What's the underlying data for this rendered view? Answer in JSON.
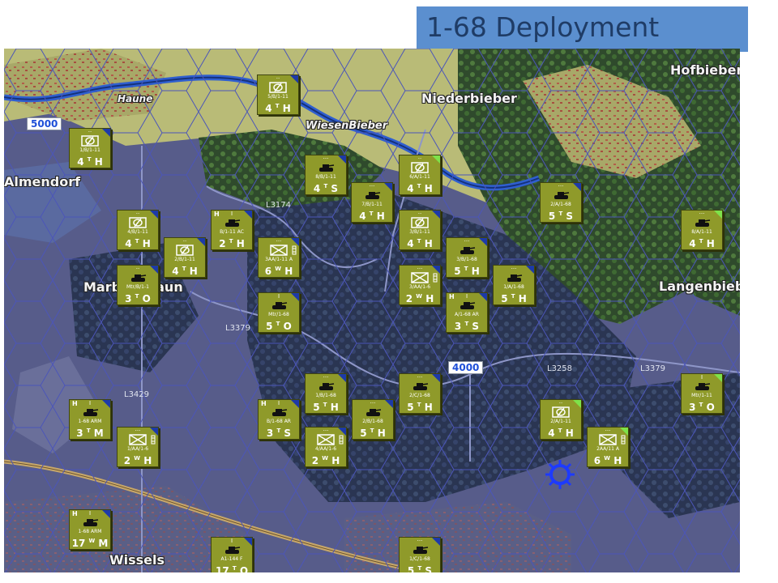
{
  "banner": {
    "title": "1-68 Deployment"
  },
  "colors": {
    "banner_bg": "#5b8fcf",
    "banner_text": "#1f3c66",
    "counter_olive": "#8f9a2a",
    "corner_blue": "#1d3aa8",
    "corner_green": "#7ee24a",
    "coord_text": "#1f4fd8"
  },
  "map": {
    "towns": [
      {
        "id": "hofbieber",
        "name": "Hofbieber"
      },
      {
        "id": "niederbieber",
        "name": "Niederbieber"
      },
      {
        "id": "wiesenbieber",
        "name": "WiesenBieber"
      },
      {
        "id": "haune",
        "name": "Haune"
      },
      {
        "id": "almendorf",
        "name": "Almendorf"
      },
      {
        "id": "marbachhaun",
        "name": "Marbachhaun"
      },
      {
        "id": "langenbieber",
        "name": "Langenbiebe"
      },
      {
        "id": "wissels",
        "name": "Wissels"
      }
    ],
    "roads": [
      "L3174",
      "L3379",
      "L3429",
      "L3258",
      "L3379"
    ],
    "coord_labels": [
      "5000",
      "4000"
    ]
  },
  "units": [
    {
      "size": "··",
      "hq": "",
      "type": "recon",
      "id": "5/B/1-11",
      "stat": "4",
      "sup": "T",
      "class": "H",
      "corner": "blue"
    },
    {
      "size": "··",
      "hq": "",
      "type": "recon",
      "id": "1/B/1-11",
      "stat": "4",
      "sup": "T",
      "class": "H",
      "corner": "blue"
    },
    {
      "size": "···",
      "hq": "",
      "type": "tank",
      "id": "8/B/1-11",
      "stat": "4",
      "sup": "T",
      "class": "S",
      "corner": "blue"
    },
    {
      "size": "··",
      "hq": "",
      "type": "recon",
      "id": "6/A/1-11",
      "stat": "4",
      "sup": "T",
      "class": "H",
      "corner": "green"
    },
    {
      "size": "···",
      "hq": "",
      "type": "tank",
      "id": "7/B/1-11",
      "stat": "4",
      "sup": "T",
      "class": "H",
      "corner": "blue"
    },
    {
      "size": "···",
      "hq": "",
      "type": "tank",
      "id": "2/A/1-68",
      "stat": "5",
      "sup": "T",
      "class": "S",
      "corner": "blue"
    },
    {
      "size": "··",
      "hq": "",
      "type": "recon",
      "id": "4/B/1-11",
      "stat": "4",
      "sup": "T",
      "class": "H",
      "corner": "blue"
    },
    {
      "size": "I",
      "hq": "H",
      "type": "tank",
      "id": "B/1-11 AC",
      "stat": "2",
      "sup": "T",
      "class": "H",
      "corner": "blue"
    },
    {
      "size": "··",
      "hq": "",
      "type": "recon",
      "id": "3/B/1-11",
      "stat": "4",
      "sup": "T",
      "class": "H",
      "corner": "blue"
    },
    {
      "size": "···",
      "hq": "",
      "type": "tank",
      "id": "8/A/1-11",
      "stat": "4",
      "sup": "T",
      "class": "H",
      "corner": "green"
    },
    {
      "size": "··",
      "hq": "",
      "type": "recon",
      "id": "2/B/1-11",
      "stat": "4",
      "sup": "T",
      "class": "H",
      "corner": "blue"
    },
    {
      "size": "···",
      "hq": "",
      "type": "infantry",
      "id": "3AA/1-11 A",
      "stat": "6",
      "sup": "W",
      "class": "H",
      "corner": "blue"
    },
    {
      "size": "···",
      "hq": "",
      "type": "tank",
      "id": "3/B/1-68",
      "stat": "5",
      "sup": "T",
      "class": "H",
      "corner": "blue"
    },
    {
      "size": "··",
      "hq": "",
      "type": "tank",
      "id": "Mtr/B/1-1",
      "stat": "3",
      "sup": "T",
      "class": "O",
      "corner": "blue"
    },
    {
      "size": "···",
      "hq": "",
      "type": "infantry",
      "id": "3/AA/1-6",
      "stat": "2",
      "sup": "W",
      "class": "H",
      "corner": "blue"
    },
    {
      "size": "···",
      "hq": "",
      "type": "tank",
      "id": "1/A/1-68",
      "stat": "5",
      "sup": "T",
      "class": "H",
      "corner": "blue"
    },
    {
      "size": "I",
      "hq": "",
      "type": "tank",
      "id": "Mtr/1-68",
      "stat": "5",
      "sup": "T",
      "class": "O",
      "corner": "blue"
    },
    {
      "size": "I",
      "hq": "H",
      "type": "tank",
      "id": "A/1-68 AR",
      "stat": "3",
      "sup": "T",
      "class": "S",
      "corner": "blue"
    },
    {
      "size": "···",
      "hq": "",
      "type": "tank",
      "id": "1/B/1-68",
      "stat": "5",
      "sup": "T",
      "class": "H",
      "corner": "blue"
    },
    {
      "size": "···",
      "hq": "",
      "type": "tank",
      "id": "2/C/1-68",
      "stat": "5",
      "sup": "T",
      "class": "H",
      "corner": "blue"
    },
    {
      "size": "I",
      "hq": "",
      "type": "tank",
      "id": "Mtr/1-11",
      "stat": "3",
      "sup": "T",
      "class": "O",
      "corner": "green"
    },
    {
      "size": "I",
      "hq": "H",
      "type": "tank",
      "id": "1-68 ARM",
      "stat": "3",
      "sup": "T",
      "class": "M",
      "corner": "blue"
    },
    {
      "size": "I",
      "hq": "H",
      "type": "tank",
      "id": "B/1-68 AR",
      "stat": "3",
      "sup": "T",
      "class": "S",
      "corner": "blue"
    },
    {
      "size": "···",
      "hq": "",
      "type": "tank",
      "id": "2/B/1-68",
      "stat": "5",
      "sup": "T",
      "class": "H",
      "corner": "blue"
    },
    {
      "size": "··",
      "hq": "",
      "type": "recon",
      "id": "2/A/1-11",
      "stat": "4",
      "sup": "T",
      "class": "H",
      "corner": "green"
    },
    {
      "size": "···",
      "hq": "",
      "type": "infantry",
      "id": "1/AA/1-6",
      "stat": "2",
      "sup": "W",
      "class": "H",
      "corner": "blue"
    },
    {
      "size": "···",
      "hq": "",
      "type": "infantry",
      "id": "4/AA/1-6",
      "stat": "2",
      "sup": "W",
      "class": "H",
      "corner": "blue"
    },
    {
      "size": "···",
      "hq": "",
      "type": "infantry",
      "id": "2AA/11 A",
      "stat": "6",
      "sup": "W",
      "class": "H",
      "corner": "green"
    },
    {
      "size": "I",
      "hq": "H",
      "type": "tank",
      "id": "1-68 ARM",
      "stat": "17",
      "sup": "W",
      "class": "M",
      "corner": "blue"
    },
    {
      "size": "I",
      "hq": "",
      "type": "tank",
      "id": "A1-144 F",
      "stat": "17",
      "sup": "T",
      "class": "O",
      "corner": "blue"
    },
    {
      "size": "···",
      "hq": "",
      "type": "tank",
      "id": "1/C/1-68",
      "stat": "5",
      "sup": "T",
      "class": "S",
      "corner": "blue"
    }
  ]
}
